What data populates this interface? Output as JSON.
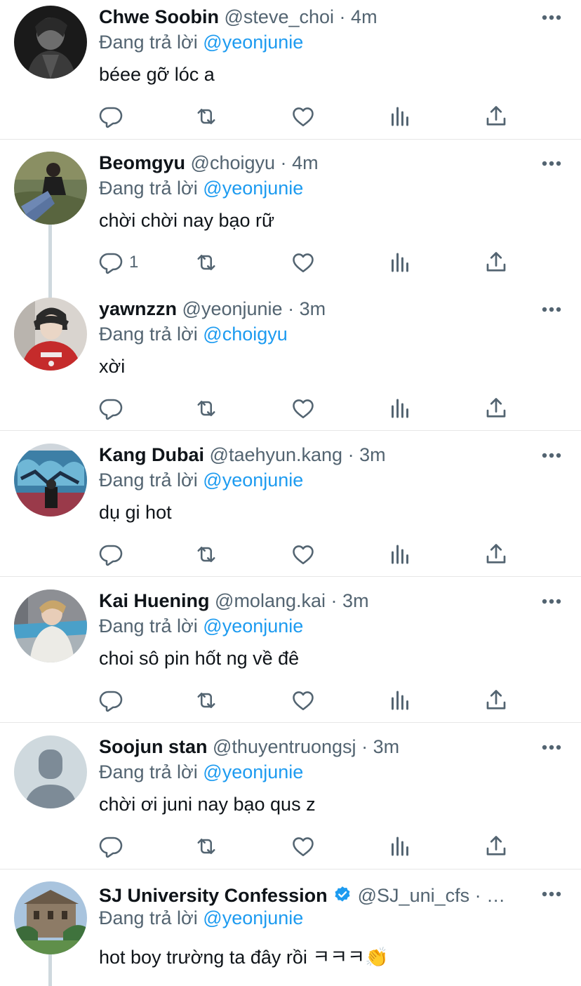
{
  "colors": {
    "accent": "#1d9bf0",
    "muted": "#536471",
    "text": "#0f1419",
    "separator": "#e6e6e6"
  },
  "icons": {
    "reply": "reply-icon",
    "retweet": "retweet-icon",
    "like": "heart-icon",
    "views": "analytics-icon",
    "share": "share-icon",
    "more": "more-icon"
  },
  "tweets": [
    {
      "name": "Chwe Soobin",
      "handle": "@steve_choi",
      "dot": "·",
      "time": "4m",
      "reply_prefix": "Đang trả lời",
      "reply_to": "@yeonjunie",
      "text": "béee gỡ lóc a",
      "reply_count": ""
    },
    {
      "name": "Beomgyu",
      "handle": "@choigyu",
      "dot": "·",
      "time": "4m",
      "reply_prefix": "Đang trả lời",
      "reply_to": "@yeonjunie",
      "text": "chời chời nay bạo rữ",
      "reply_count": "1"
    },
    {
      "name": "yawnzzn",
      "handle": "@yeonjunie",
      "dot": "·",
      "time": "3m",
      "reply_prefix": "Đang trả lời",
      "reply_to": "@choigyu",
      "text": "xời",
      "reply_count": ""
    },
    {
      "name": "Kang Dubai",
      "handle": "@taehyun.kang",
      "dot": "·",
      "time": "3m",
      "reply_prefix": "Đang trả lời",
      "reply_to": "@yeonjunie",
      "text": "dụ gi hot",
      "reply_count": ""
    },
    {
      "name": "Kai Huening",
      "handle": "@molang.kai",
      "dot": "·",
      "time": "3m",
      "reply_prefix": "Đang trả lời",
      "reply_to": "@yeonjunie",
      "text": "choi sô pin hốt ng về đê",
      "reply_count": ""
    },
    {
      "name": "Soojun stan",
      "handle": "@thuyentruongsj",
      "dot": "·",
      "time": "3m",
      "reply_prefix": "Đang trả lời",
      "reply_to": "@yeonjunie",
      "text": "chời ơi juni nay bạo qus z",
      "reply_count": ""
    },
    {
      "name": "SJ University Confession",
      "handle": "@SJ_uni_cfs",
      "dot": "·",
      "time": "…",
      "reply_prefix": "Đang trả lời",
      "reply_to": "@yeonjunie",
      "text": "hot boy trường ta đây rồi ㅋㅋㅋ👏",
      "reply_count": ""
    }
  ]
}
